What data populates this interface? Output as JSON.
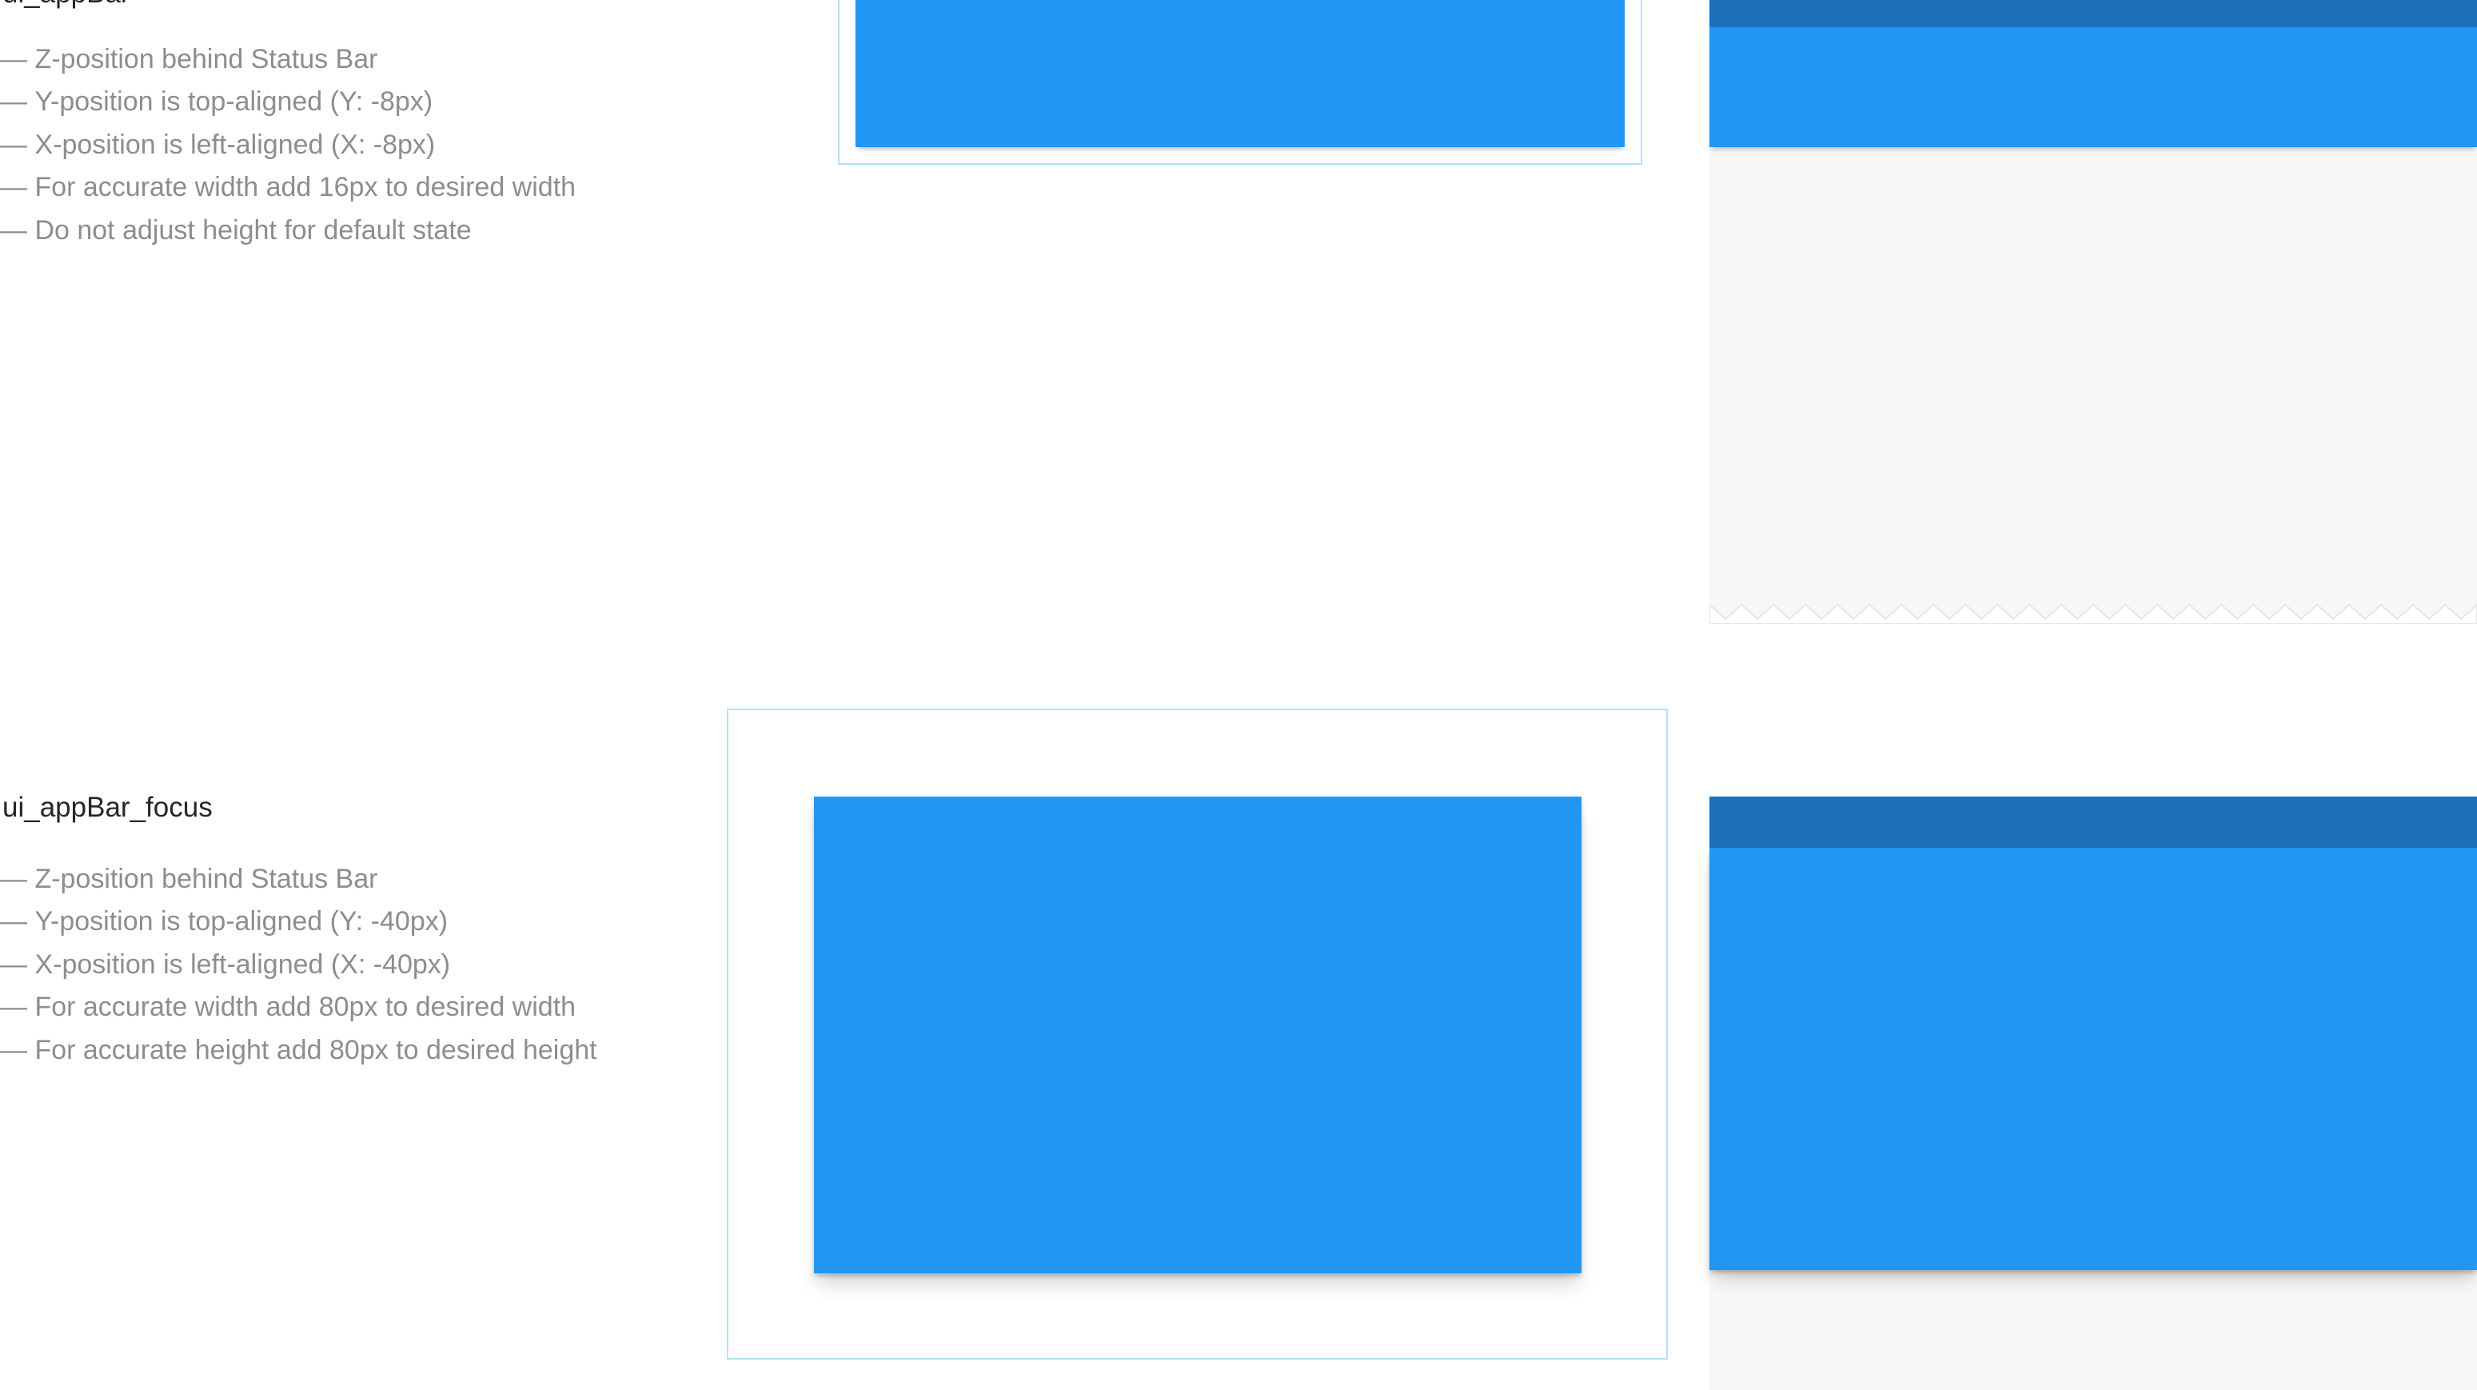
{
  "sections": {
    "default": {
      "title": "ui_appBar",
      "notes": [
        "Z-position behind Status Bar",
        "Y-position is top-aligned (Y: -8px)",
        "X-position is left-aligned (X: -8px)",
        "For accurate width add 16px to desired width",
        "Do not adjust height for default state"
      ]
    },
    "focus": {
      "title": "ui_appBar_focus",
      "notes": [
        "Z-position behind Status Bar",
        "Y-position is top-aligned (Y: -40px)",
        "X-position is left-aligned (X: -40px)",
        "For accurate width add 80px to desired width",
        "For accurate height add 80px to desired height"
      ]
    }
  },
  "colors": {
    "app_bar": "#2196f3",
    "status_bar": "#1c70b7",
    "frame_border": "#b6e1f6",
    "phone_background": "#f7f7f7",
    "note_text": "#8d8d8d",
    "title_text": "#262626"
  }
}
